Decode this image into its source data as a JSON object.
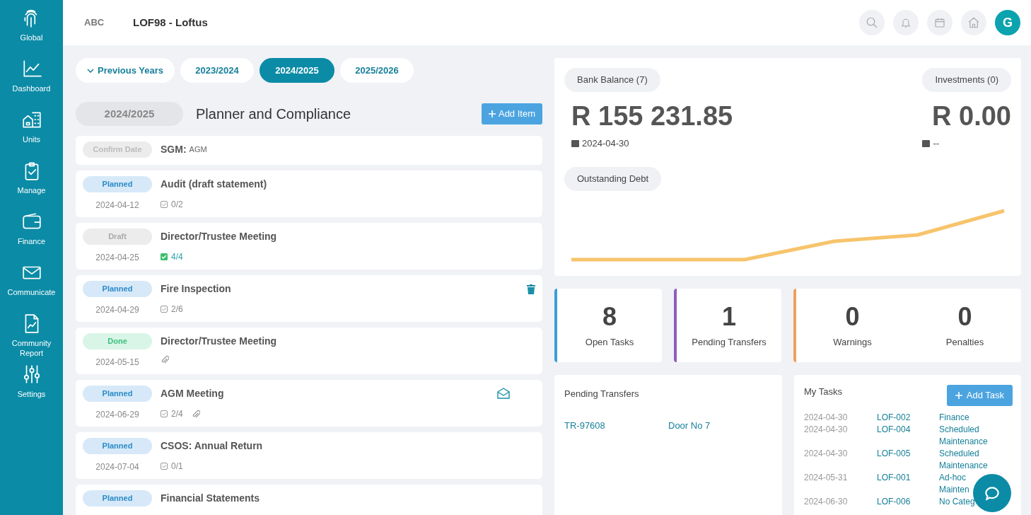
{
  "sidebar": {
    "items": [
      {
        "label": "Global"
      },
      {
        "label": "Dashboard"
      },
      {
        "label": "Units"
      },
      {
        "label": "Manage"
      },
      {
        "label": "Finance"
      },
      {
        "label": "Communicate"
      },
      {
        "label": "Community Report"
      },
      {
        "label": "Settings"
      }
    ]
  },
  "header": {
    "logo": "ABC",
    "title": "LOF98 - Loftus",
    "avatar": "G"
  },
  "year_tabs": {
    "dropdown": "Previous Years",
    "tabs": [
      {
        "label": "2023/2024",
        "selected": false
      },
      {
        "label": "2024/2025",
        "selected": true
      },
      {
        "label": "2025/2026",
        "selected": false
      }
    ]
  },
  "planner": {
    "year": "2024/2025",
    "title": "Planner and Compliance",
    "add_button": "Add Item",
    "items": [
      {
        "status": {
          "label": "Confirm Date",
          "kind": "confirm"
        },
        "title": "SGM:",
        "subtitle": "AGM"
      },
      {
        "status": {
          "label": "Planned",
          "kind": "planned"
        },
        "title": "Audit (draft statement)",
        "date": "2024-04-12",
        "checklist": {
          "text": "0/2",
          "complete": false
        }
      },
      {
        "status": {
          "label": "Draft",
          "kind": "draft"
        },
        "title": "Director/Trustee Meeting",
        "date": "2024-04-25",
        "checklist": {
          "text": "4/4",
          "complete": true
        }
      },
      {
        "status": {
          "label": "Planned",
          "kind": "planned"
        },
        "title": "Fire Inspection",
        "date": "2024-04-29",
        "checklist": {
          "text": "2/6",
          "complete": false
        },
        "trash": true
      },
      {
        "status": {
          "label": "Done",
          "kind": "done"
        },
        "title": "Director/Trustee Meeting",
        "date": "2024-05-15",
        "attachment": true
      },
      {
        "status": {
          "label": "Planned",
          "kind": "planned"
        },
        "title": "AGM Meeting",
        "date": "2024-06-29",
        "checklist": {
          "text": "2/4",
          "complete": false
        },
        "attachment": true,
        "email": true
      },
      {
        "status": {
          "label": "Planned",
          "kind": "planned"
        },
        "title": "CSOS: Annual Return",
        "date": "2024-07-04",
        "checklist": {
          "text": "0/1",
          "complete": false
        }
      },
      {
        "status": {
          "label": "Planned",
          "kind": "planned"
        },
        "title": "Financial Statements"
      }
    ]
  },
  "balances": {
    "bank": {
      "label": "Bank Balance (7)",
      "amount": "R 155 231.85",
      "date": "2024-04-30"
    },
    "investments": {
      "label": "Investments (0)",
      "amount": "R 0.00",
      "date": "--"
    },
    "debt": {
      "label": "Outstanding Debt"
    }
  },
  "stats": [
    {
      "color": "#3b9fd8",
      "items": [
        {
          "value": "8",
          "label": "Open Tasks"
        }
      ]
    },
    {
      "color": "#8e5cc0",
      "items": [
        {
          "value": "1",
          "label": "Pending Transfers"
        }
      ]
    },
    {
      "color": "#f0a060",
      "items": [
        {
          "value": "0",
          "label": "Warnings"
        },
        {
          "value": "0",
          "label": "Penalties"
        }
      ]
    }
  ],
  "pending_transfers": {
    "title": "Pending Transfers",
    "rows": [
      {
        "ref": "TR-97608",
        "unit": "Door No 7"
      }
    ]
  },
  "my_tasks": {
    "title": "My Tasks",
    "add_button": "Add Task",
    "rows": [
      {
        "date": "2024-04-30",
        "ref": "LOF-002",
        "category": "Finance"
      },
      {
        "date": "2024-04-30",
        "ref": "LOF-004",
        "category": "Scheduled Maintenance"
      },
      {
        "date": "2024-04-30",
        "ref": "LOF-005",
        "category": "Scheduled Maintenance"
      },
      {
        "date": "2024-05-31",
        "ref": "LOF-001",
        "category": "Ad-hoc Mainten"
      },
      {
        "date": "2024-06-30",
        "ref": "LOF-006",
        "category": "No Categ"
      }
    ]
  }
}
